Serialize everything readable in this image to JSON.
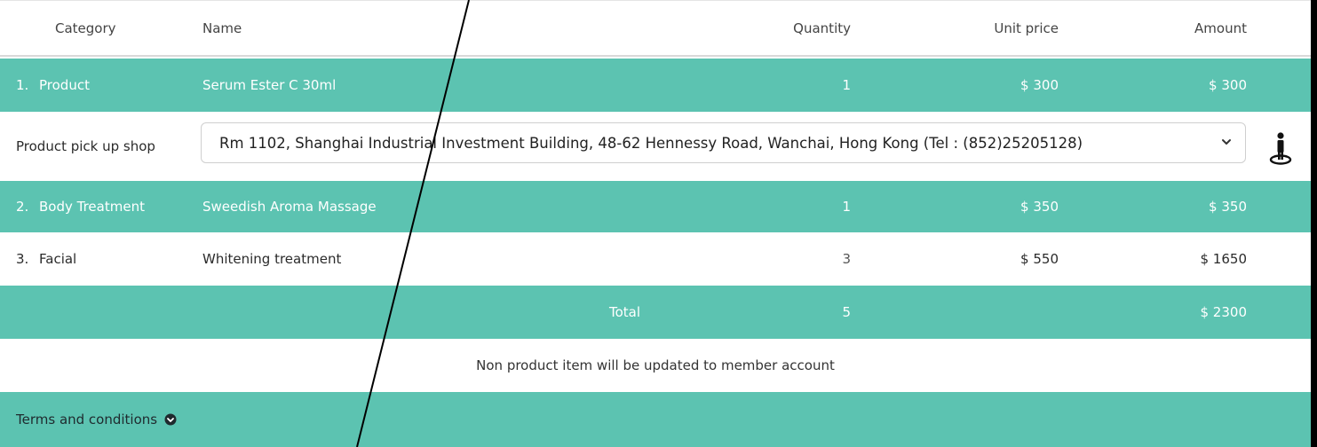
{
  "header": {
    "category": "Category",
    "name": "Name",
    "quantity": "Quantity",
    "unit_price": "Unit price",
    "amount": "Amount"
  },
  "items": [
    {
      "num": "1.",
      "category": "Product",
      "name": "Serum Ester C 30ml",
      "quantity": "1",
      "unit_price": "$ 300",
      "amount": "$ 300"
    },
    {
      "num": "2.",
      "category": "Body Treatment",
      "name": "Sweedish Aroma Massage",
      "quantity": "1",
      "unit_price": "$ 350",
      "amount": "$ 350"
    },
    {
      "num": "3.",
      "category": "Facial",
      "name": "Whitening treatment",
      "quantity": "3",
      "unit_price": "$ 550",
      "amount": "$ 1650"
    }
  ],
  "pickup": {
    "label": "Product pick up shop",
    "selected": "Rm 1102, Shanghai Industrial Investment Building, 48-62 Hennessy Road, Wanchai, Hong Kong (Tel : (852)25205128)",
    "icon": "person-location-icon"
  },
  "total": {
    "label": "Total",
    "quantity": "5",
    "amount": "$ 2300"
  },
  "note": "Non product item will be updated to member account",
  "terms": {
    "label": "Terms and conditions",
    "icon": "chevron-circle-down-icon"
  },
  "colors": {
    "accent": "#5cc3b1"
  }
}
